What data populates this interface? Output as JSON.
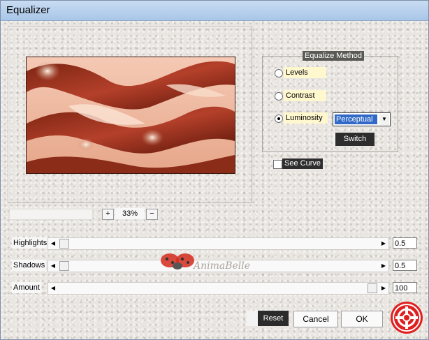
{
  "window": {
    "title": "Equalizer"
  },
  "zoom": {
    "plus_label": "+",
    "minus_label": "−",
    "value": "33%"
  },
  "method": {
    "title": "Equalize Method",
    "options": [
      {
        "label": "Levels",
        "selected": false
      },
      {
        "label": "Contrast",
        "selected": false
      },
      {
        "label": "Luminosity",
        "selected": true
      }
    ],
    "mode_select": {
      "value": "Perceptual"
    },
    "switch_label": "Switch"
  },
  "see_curve": {
    "label": "See Curve",
    "checked": false
  },
  "sliders": [
    {
      "label": "Highlights",
      "value": "0.5"
    },
    {
      "label": "Shadows",
      "value": "0.5"
    },
    {
      "label": "Amount",
      "value": "100"
    }
  ],
  "watermark": {
    "text": "AnimaBelle"
  },
  "buttons": {
    "reset": "Reset",
    "cancel": "Cancel",
    "ok": "OK"
  },
  "colors": {
    "title_bar": "#b8d0ee",
    "highlight": "#3169c6",
    "label_bg": "#fff8cf",
    "logo_red": "#e02020"
  }
}
